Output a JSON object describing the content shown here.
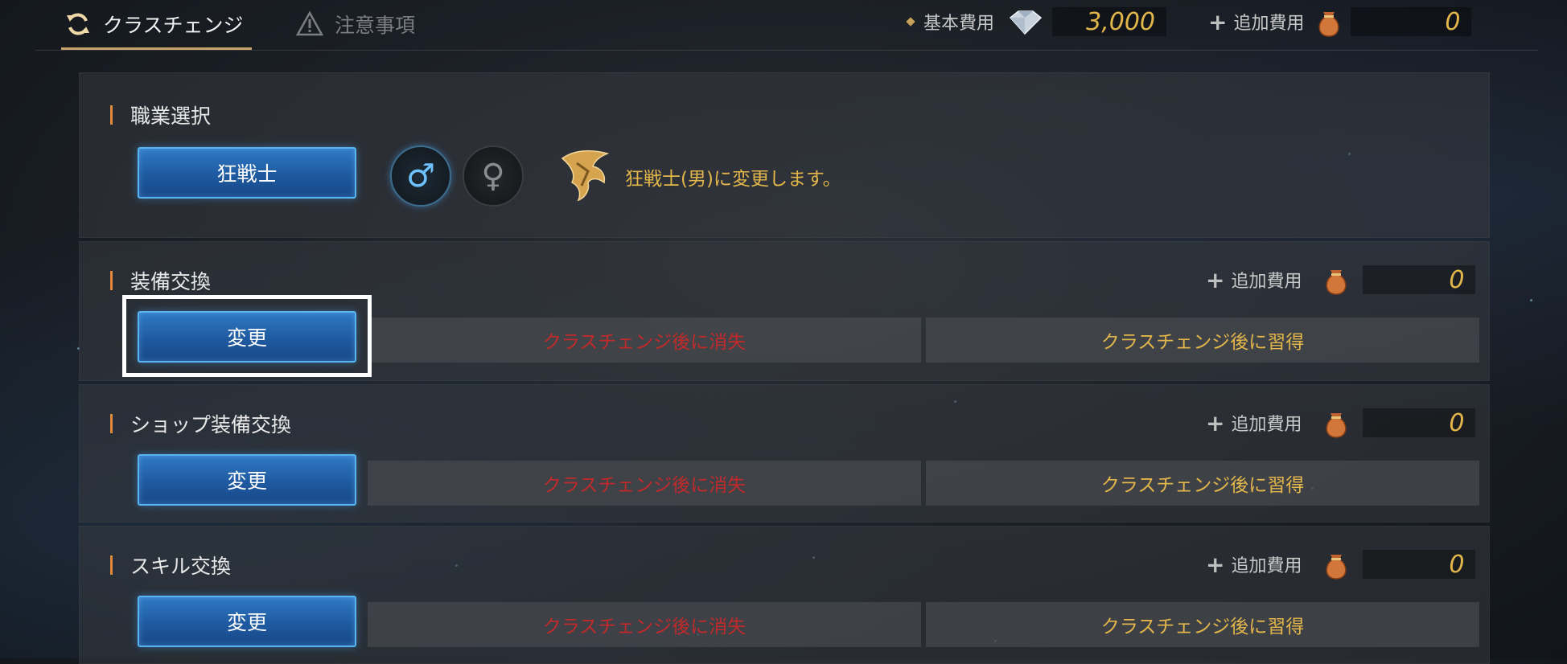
{
  "tabs": [
    {
      "label": "クラスチェンジ",
      "icon": "refresh-icon",
      "active": true
    },
    {
      "label": "注意事項",
      "icon": "warning-icon",
      "active": false
    }
  ],
  "header_costs": {
    "base_label": "基本費用",
    "base_value": "3,000",
    "base_icon": "diamond-gem-icon",
    "additional_label": "追加費用",
    "additional_value": "0",
    "additional_icon": "pouch-icon"
  },
  "job_select": {
    "title": "職業選択",
    "class_button": "狂戦士",
    "male_symbol": "♂",
    "female_symbol": "♀",
    "message": "狂戦士(男)に変更します。"
  },
  "sections": [
    {
      "title": "装備交換",
      "add_cost_label": "追加費用",
      "add_cost_value": "0",
      "change_button": "変更",
      "lost_label": "クラスチェンジ後に消失",
      "gain_label": "クラスチェンジ後に習得"
    },
    {
      "title": "ショップ装備交換",
      "add_cost_label": "追加費用",
      "add_cost_value": "0",
      "change_button": "変更",
      "lost_label": "クラスチェンジ後に消失",
      "gain_label": "クラスチェンジ後に習得"
    },
    {
      "title": "スキル交換",
      "add_cost_label": "追加費用",
      "add_cost_value": "0",
      "change_button": "変更",
      "lost_label": "クラスチェンジ後に消失",
      "gain_label": "クラスチェンジ後に習得"
    }
  ],
  "colors": {
    "accent_orange": "#e3893a",
    "gold_text": "#e2b64a",
    "lost_red": "#c12a2a",
    "button_blue": "#1f5aa0"
  }
}
